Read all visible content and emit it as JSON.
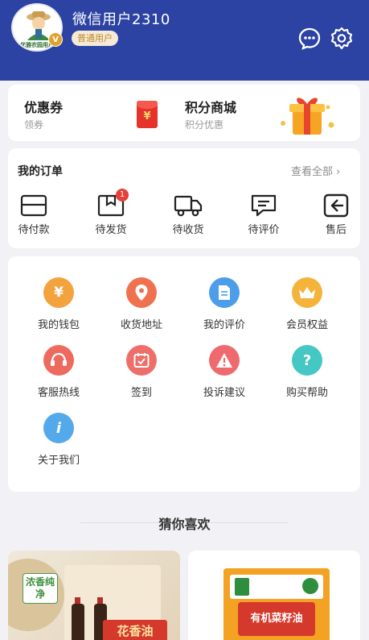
{
  "user": {
    "avatar_text": "优雅农园用户",
    "avatar_badge": "V",
    "name": "微信用户2310",
    "level": "普通用户"
  },
  "header_icons": [
    "chat-icon",
    "gear-icon"
  ],
  "promo": {
    "coupon_title": "优惠券",
    "coupon_sub": "领券",
    "coupon_icon": "¥",
    "mall_title": "积分商城",
    "mall_sub": "积分优惠"
  },
  "orders": {
    "title": "我的订单",
    "view_all": "查看全部",
    "items": [
      {
        "label": "待付款",
        "icon": "wallet-icon"
      },
      {
        "label": "待发货",
        "icon": "package-icon",
        "badge": "1"
      },
      {
        "label": "待收货",
        "icon": "truck-icon"
      },
      {
        "label": "待评价",
        "icon": "comment-icon"
      },
      {
        "label": "售后",
        "icon": "return-icon"
      }
    ]
  },
  "services": [
    {
      "label": "我的钱包",
      "icon": "yuan-icon",
      "color": "#f3a33e"
    },
    {
      "label": "收货地址",
      "icon": "location-pin-icon",
      "color": "#ef7250"
    },
    {
      "label": "我的评价",
      "icon": "document-icon",
      "color": "#4d9ee9"
    },
    {
      "label": "会员权益",
      "icon": "crown-icon",
      "color": "#f4b43c"
    },
    {
      "label": "客服热线",
      "icon": "headset-icon",
      "color": "#ef6a5e"
    },
    {
      "label": "签到",
      "icon": "calendar-check-icon",
      "color": "#ee6f69"
    },
    {
      "label": "投诉建议",
      "icon": "warning-icon",
      "color": "#ef6a6e"
    },
    {
      "label": "购买帮助",
      "icon": "question-icon",
      "color": "#45c7c3"
    },
    {
      "label": "关于我们",
      "icon": "info-icon",
      "color": "#54a9ea"
    }
  ],
  "recommend": {
    "title": "猜你喜欢",
    "product1_text": "浓香纯净",
    "product1_banner": "花香油",
    "product2_text": "有机菜籽油"
  },
  "colors": {
    "header": "#2c43a3",
    "badge": "#e6403a",
    "level_tag_bg": "#f5ead7"
  }
}
